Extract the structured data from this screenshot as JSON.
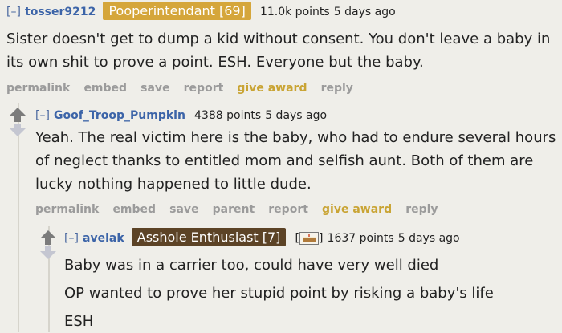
{
  "comment1": {
    "toggle": "[–]",
    "author": "tosser9212",
    "flair": "Pooperintendant [69]",
    "points": "11.0k points",
    "age": "5 days ago",
    "body": "Sister doesn't get to dump a kid without consent. You don't leave a baby in its own shit to prove a point. ESH. Everyone but the baby.",
    "actions": [
      "permalink",
      "embed",
      "save",
      "report",
      "give award",
      "reply"
    ]
  },
  "comment2": {
    "toggle": "[–]",
    "author": "Goof_Troop_Pumpkin",
    "points": "4388 points",
    "age": "5 days ago",
    "body": "Yeah. The real victim here is the baby, who had to endure several hours of neglect thanks to entitled mom and selfish aunt. Both of them are lucky nothing happened to little dude.",
    "actions": [
      "permalink",
      "embed",
      "save",
      "parent",
      "report",
      "give award",
      "reply"
    ]
  },
  "comment3": {
    "toggle": "[–]",
    "author": "avelak",
    "flair": "Asshole Enthusiast [7]",
    "badge_open": "[",
    "badge_close": "]",
    "points": "1637 points",
    "age": "5 days ago",
    "lines": [
      "Baby was in a carrier too, could have very well died",
      "OP wanted to prove her stupid point by risking a baby's life",
      "ESH"
    ]
  },
  "icons": {
    "upvote": "up-arrow-icon",
    "downvote": "down-arrow-icon",
    "badge": "cake-icon"
  },
  "colors": {
    "background": "#efeee9",
    "author": "#3c64a8",
    "flair_gold": "#d5a63b",
    "flair_brown": "#5c4326",
    "give_award": "#c9a434"
  }
}
